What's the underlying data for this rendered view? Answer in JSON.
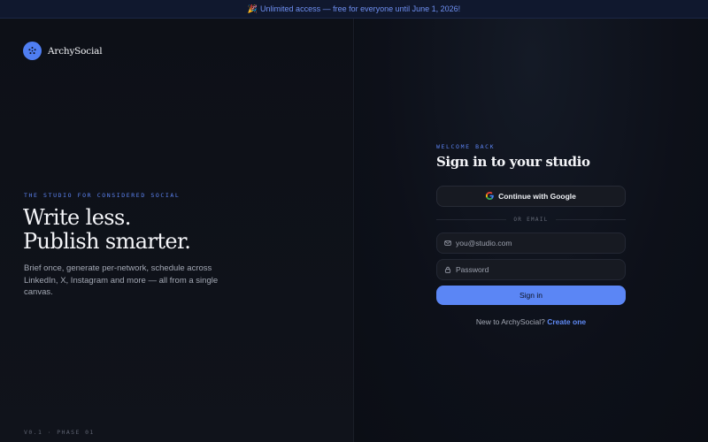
{
  "banner": {
    "emoji": "🎉",
    "text": "Unlimited access — free for everyone until June 1, 2026!"
  },
  "brand": {
    "name": "ArchySocial",
    "logo_icon": "sparkle-icon"
  },
  "hero": {
    "eyebrow": "THE STUDIO FOR CONSIDERED SOCIAL",
    "headline_line1": "Write less.",
    "headline_line2": "Publish smarter.",
    "lede": "Brief once, generate per-network, schedule across LinkedIn, X, Instagram and more — all from a single canvas.",
    "version": "V0.1 · PHASE 01"
  },
  "auth": {
    "eyebrow": "WELCOME BACK",
    "title": "Sign in to your studio",
    "google_label": "Continue with Google",
    "divider": "OR EMAIL",
    "email_placeholder": "you@studio.com",
    "password_placeholder": "Password",
    "submit_label": "Sign in",
    "signup_prompt": "New to ArchySocial?",
    "signup_link": "Create one"
  },
  "colors": {
    "accent": "#5b86f5",
    "background": "#0b0e15",
    "banner_text": "#6f90f2"
  }
}
